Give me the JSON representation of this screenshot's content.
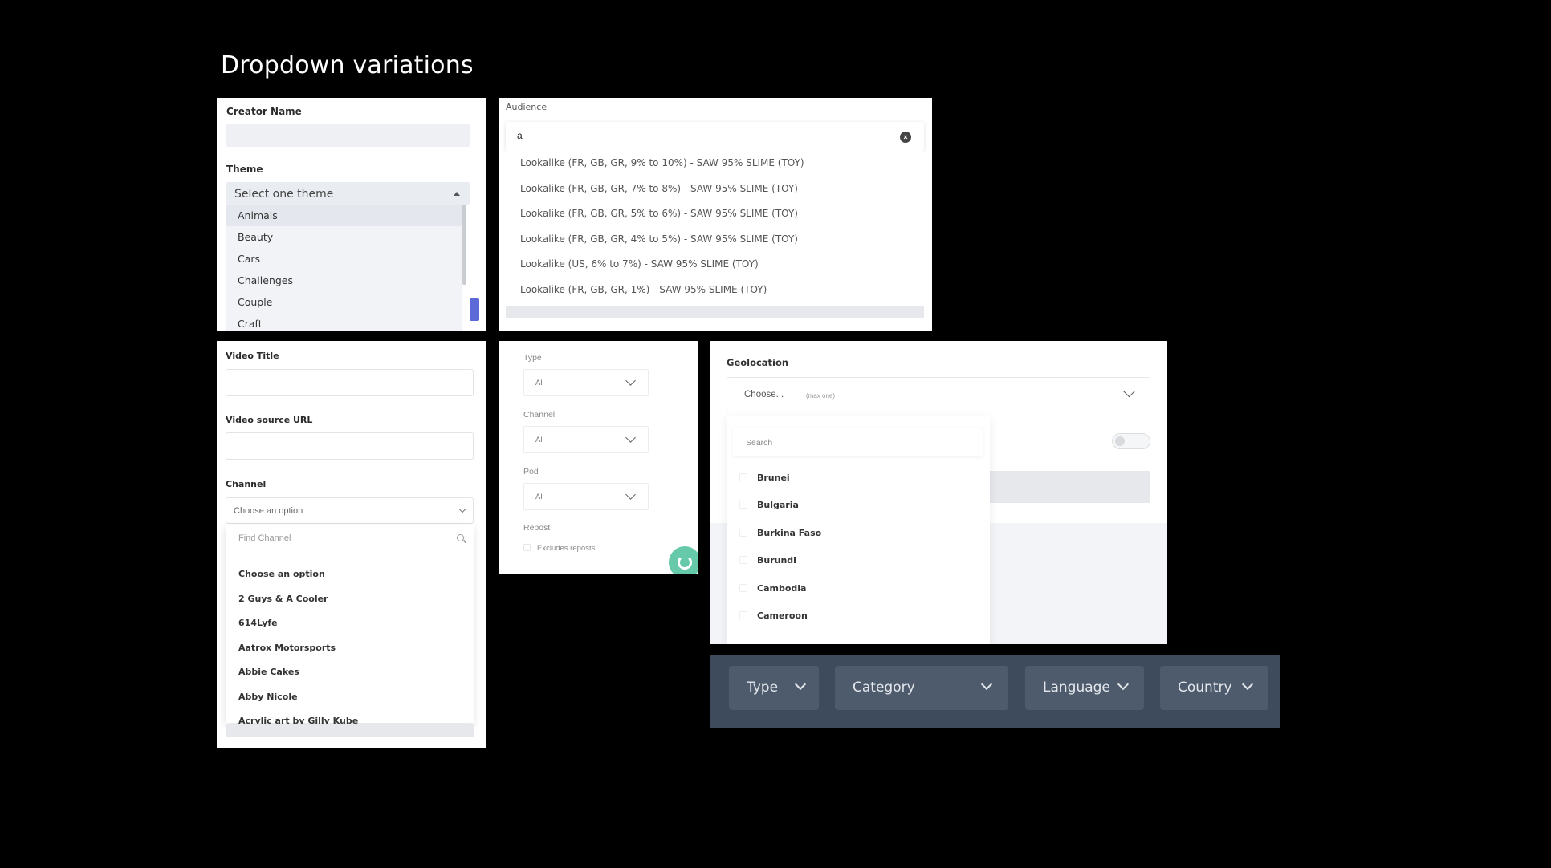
{
  "page": {
    "title": "Dropdown variations"
  },
  "creator_panel": {
    "creator_name_label": "Creator Name",
    "theme_label": "Theme",
    "theme_placeholder": "Select one theme",
    "themes": [
      "Animals",
      "Beauty",
      "Cars",
      "Challenges",
      "Couple",
      "Craft"
    ]
  },
  "audience_panel": {
    "label": "Audience",
    "search_value": "a",
    "options": [
      "Lookalike (FR, GB, GR, 9% to 10%) - SAW 95% SLIME (TOY)",
      "Lookalike (FR, GB, GR, 7% to 8%) - SAW 95% SLIME (TOY)",
      "Lookalike (FR, GB, GR, 5% to 6%) - SAW 95% SLIME (TOY)",
      "Lookalike (FR, GB, GR, 4% to 5%) - SAW 95% SLIME (TOY)",
      "Lookalike (US, 6% to 7%) - SAW 95% SLIME (TOY)",
      "Lookalike (FR, GB, GR, 1%) - SAW 95% SLIME (TOY)"
    ]
  },
  "video_panel": {
    "title_label": "Video Title",
    "source_label": "Video source URL",
    "channel_label": "Channel",
    "channel_placeholder": "Choose an option",
    "find_placeholder": "Find Channel",
    "channels": [
      "Choose an option",
      "2 Guys & A Cooler",
      "614Lyfe",
      "Aatrox Motorsports",
      "Abbie Cakes",
      "Abby Nicole",
      "Acrylic art by Gilly Kube"
    ]
  },
  "filter_panel": {
    "type_label": "Type",
    "type_value": "All",
    "channel_label": "Channel",
    "channel_value": "All",
    "pod_label": "Pod",
    "pod_value": "All",
    "repost_label": "Repost",
    "repost_option": "Excludes reposts"
  },
  "geo_panel": {
    "label": "Geolocation",
    "placeholder": "Choose...",
    "hint": "(max one)",
    "search_placeholder": "Search",
    "countries": [
      "Brunei",
      "Bulgaria",
      "Burkina Faso",
      "Burundi",
      "Cambodia",
      "Cameroon"
    ]
  },
  "dark_bar": {
    "type": "Type",
    "category": "Category",
    "language": "Language",
    "country": "Country"
  }
}
